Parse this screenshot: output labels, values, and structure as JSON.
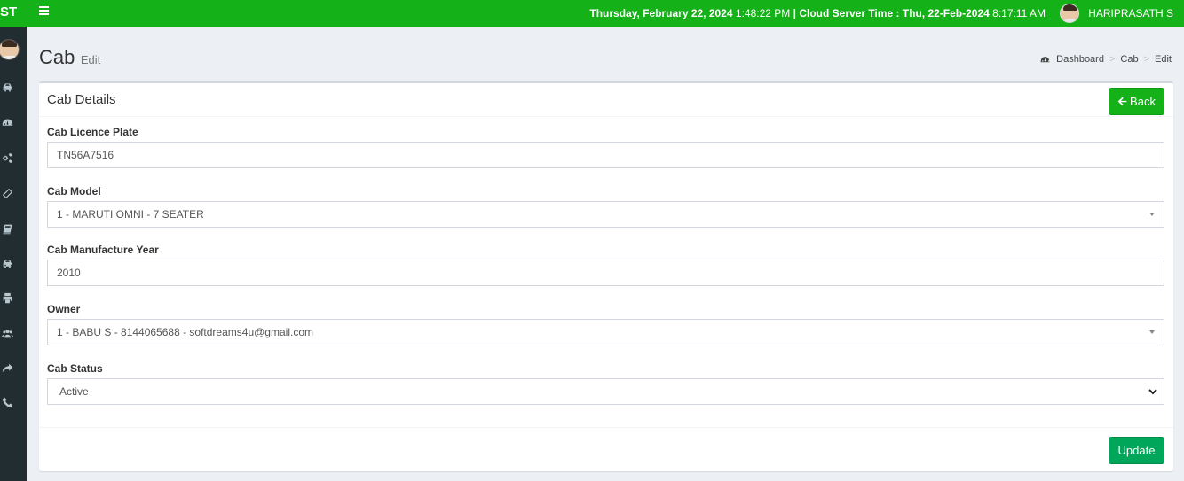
{
  "header": {
    "logo_text": "ST",
    "date_text": "Thursday, February 22, 2024",
    "time_text": "1:48:22 PM",
    "separator": "|",
    "server_label": "Cloud Server Time : Thu, 22-Feb-2024",
    "server_time": "8:17:11 AM",
    "user_name": "HARIPRASATH S"
  },
  "sidebar": {
    "icons": [
      "cab-icon",
      "dashboard-icon",
      "settings-icon",
      "ticket-icon",
      "book-icon",
      "cab-icon",
      "print-icon",
      "users-icon",
      "share-icon",
      "phone-icon"
    ]
  },
  "page": {
    "title": "Cab",
    "subtitle": "Edit"
  },
  "breadcrumb": {
    "items": [
      "Dashboard",
      "Cab",
      "Edit"
    ]
  },
  "box": {
    "title": "Cab Details",
    "back_label": "Back",
    "update_label": "Update"
  },
  "form": {
    "licence_plate": {
      "label": "Cab Licence Plate",
      "value": "TN56A7516"
    },
    "model": {
      "label": "Cab Model",
      "value": "1 - MARUTI OMNI - 7 SEATER"
    },
    "manufacture_year": {
      "label": "Cab Manufacture Year",
      "value": "2010"
    },
    "owner": {
      "label": "Owner",
      "value": "1 - BABU S - 8144065688 - softdreams4u@gmail.com"
    },
    "status": {
      "label": "Cab Status",
      "value": "Active"
    }
  },
  "colors": {
    "header_green": "#15b118",
    "sidebar_dark": "#222d32",
    "update_green": "#00a65a"
  }
}
